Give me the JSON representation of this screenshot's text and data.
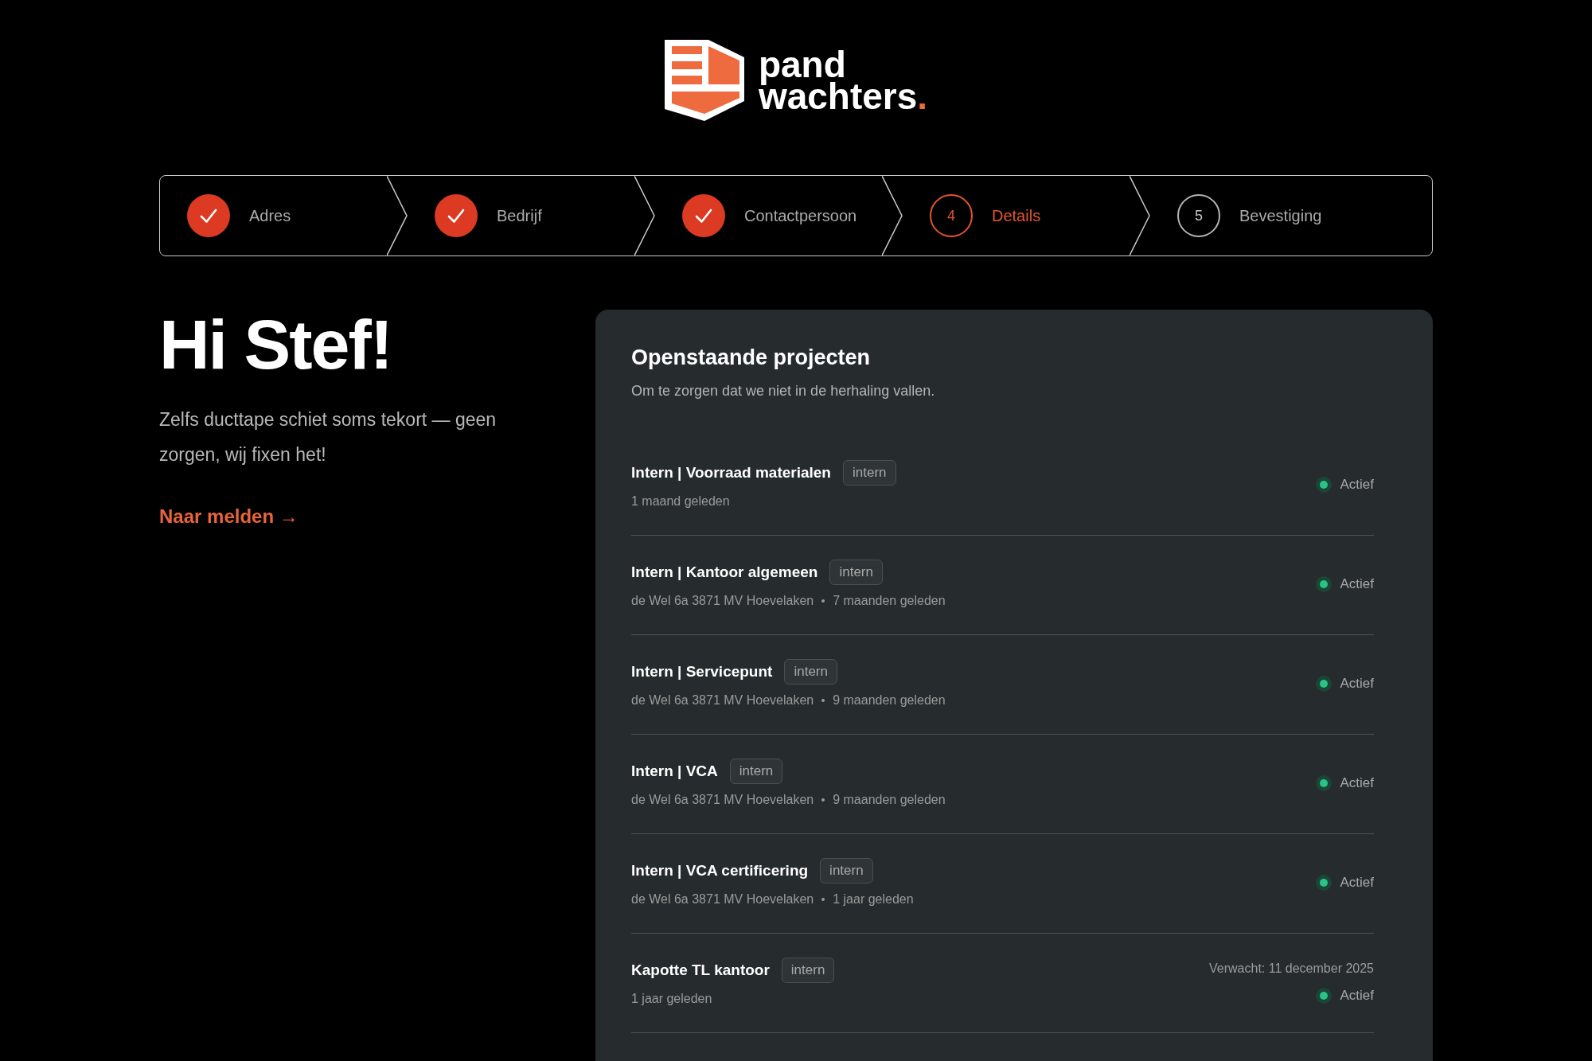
{
  "logo": {
    "wordmark_lines": [
      "pand",
      "wachters"
    ],
    "wordmark_dot": "."
  },
  "steps": [
    {
      "label": "Adres",
      "completed": true,
      "selected": false
    },
    {
      "label": "Bedrijf",
      "completed": true,
      "selected": false
    },
    {
      "label": "Contactpersoon",
      "completed": true,
      "selected": false
    },
    {
      "label": "Details",
      "number": "4",
      "completed": false,
      "selected": true
    },
    {
      "label": "Bevestiging",
      "number": "5",
      "completed": false,
      "selected": false
    }
  ],
  "greeting": {
    "heading": "Hi Stef!",
    "intro": "Zelfs ducttape schiet soms tekort — geen zorgen, wij fixen het!",
    "link": "Naar melden →"
  },
  "projects": {
    "title": "Openstaande projecten",
    "subtitle": "Om te zorgen dat we niet in de herhaling vallen.",
    "rows": [
      {
        "title": "Intern | Voorraad materialen",
        "tag": "intern",
        "age": "1 maand geleden",
        "status": "Actief"
      },
      {
        "title": "Intern | Kantoor algemeen",
        "tag": "intern",
        "address": "de Wel 6a 3871 MV Hoevelaken",
        "age": "7 maanden geleden",
        "status": "Actief"
      },
      {
        "title": "Intern | Servicepunt",
        "tag": "intern",
        "address": "de Wel 6a 3871 MV Hoevelaken",
        "age": "9 maanden geleden",
        "status": "Actief"
      },
      {
        "title": "Intern | VCA",
        "tag": "intern",
        "address": "de Wel 6a 3871 MV Hoevelaken",
        "age": "9 maanden geleden",
        "status": "Actief"
      },
      {
        "title": "Intern | VCA certificering",
        "tag": "intern",
        "address": "de Wel 6a 3871 MV Hoevelaken",
        "age": "1 jaar geleden",
        "status": "Actief"
      },
      {
        "title": "Kapotte TL kantoor",
        "tag": "intern",
        "age": "1 jaar geleden",
        "expected": "Verwacht: 11 december 2025",
        "status": "Actief"
      }
    ]
  }
}
